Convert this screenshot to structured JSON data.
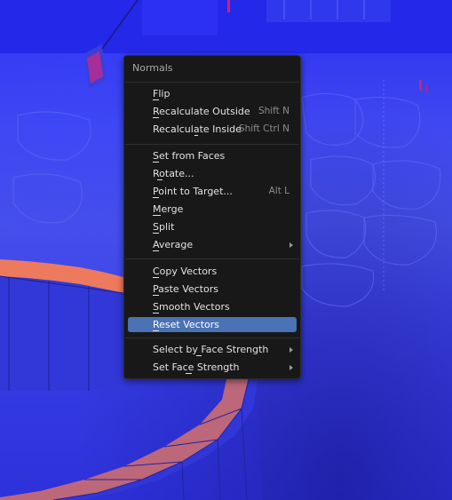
{
  "menu": {
    "title": "Normals",
    "groups": [
      [
        {
          "label": "Flip",
          "shortcut": ""
        },
        {
          "label": "Recalculate Outside",
          "shortcut": "Shift N"
        },
        {
          "label": "Recalculate Inside",
          "shortcut": "Shift Ctrl N"
        }
      ],
      [
        {
          "label": "Set from Faces",
          "shortcut": ""
        },
        {
          "label": "Rotate...",
          "shortcut": ""
        },
        {
          "label": "Point to Target...",
          "shortcut": "Alt L"
        },
        {
          "label": "Merge",
          "shortcut": ""
        },
        {
          "label": "Split",
          "shortcut": ""
        },
        {
          "label": "Average",
          "shortcut": "",
          "submenu": true
        }
      ],
      [
        {
          "label": "Copy Vectors",
          "shortcut": ""
        },
        {
          "label": "Paste Vectors",
          "shortcut": ""
        },
        {
          "label": "Smooth Vectors",
          "shortcut": ""
        },
        {
          "label": "Reset Vectors",
          "shortcut": "",
          "active": true
        }
      ],
      [
        {
          "label": "Select by Face Strength",
          "shortcut": "",
          "submenu": true
        },
        {
          "label": "Set Face Strength",
          "shortcut": "",
          "submenu": true
        }
      ]
    ]
  },
  "colors": {
    "viewport_blue": "#3a40e6",
    "face_orange": "#f07a5c",
    "menu_bg": "#181818",
    "highlight": "#4a72b4"
  }
}
